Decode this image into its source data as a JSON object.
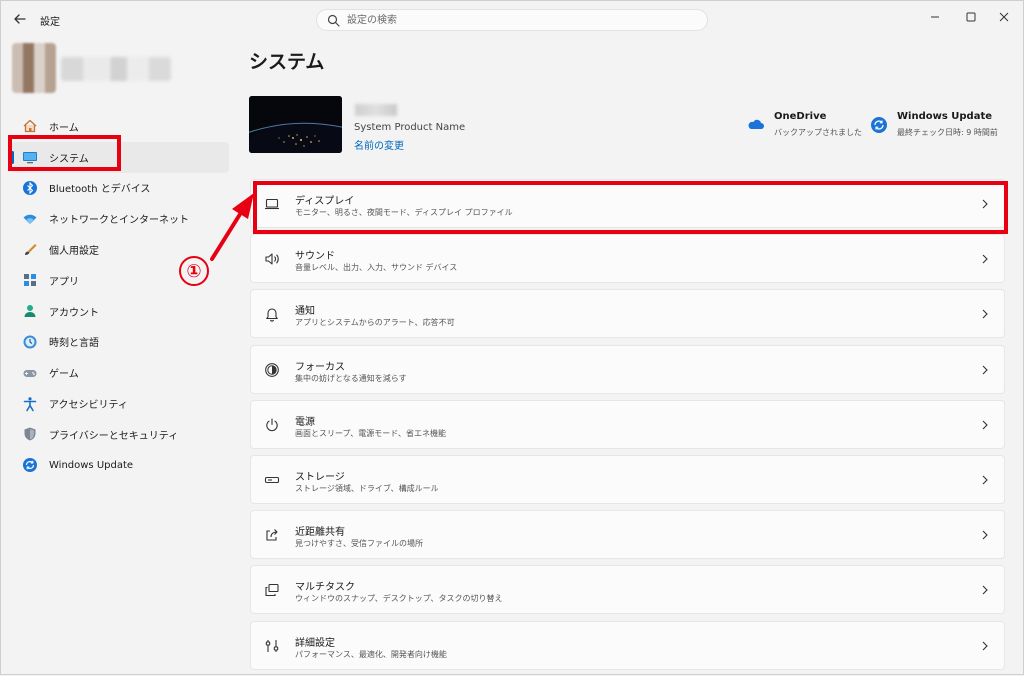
{
  "window": {
    "title": "設定"
  },
  "search": {
    "placeholder": "設定の検索"
  },
  "sidebar": {
    "items": [
      {
        "label": "ホーム",
        "icon": "home-icon",
        "selected": false
      },
      {
        "label": "システム",
        "icon": "system-icon",
        "selected": true
      },
      {
        "label": "Bluetooth とデバイス",
        "icon": "bluetooth-icon",
        "selected": false
      },
      {
        "label": "ネットワークとインターネット",
        "icon": "network-icon",
        "selected": false
      },
      {
        "label": "個人用設定",
        "icon": "personalization-icon",
        "selected": false
      },
      {
        "label": "アプリ",
        "icon": "apps-icon",
        "selected": false
      },
      {
        "label": "アカウント",
        "icon": "account-icon",
        "selected": false
      },
      {
        "label": "時刻と言語",
        "icon": "time-language-icon",
        "selected": false
      },
      {
        "label": "ゲーム",
        "icon": "gaming-icon",
        "selected": false
      },
      {
        "label": "アクセシビリティ",
        "icon": "accessibility-icon",
        "selected": false
      },
      {
        "label": "プライバシーとセキュリティ",
        "icon": "privacy-shield-icon",
        "selected": false
      },
      {
        "label": "Windows Update",
        "icon": "windows-update-icon",
        "selected": false
      }
    ]
  },
  "main": {
    "title": "システム",
    "device": {
      "model": "System Product Name",
      "rename_label": "名前の変更"
    },
    "services": {
      "onedrive": {
        "title": "OneDrive",
        "status": "バックアップされました"
      },
      "windows_update": {
        "title": "Windows Update",
        "status": "最終チェック日時: 9 時間前"
      }
    },
    "cards": [
      {
        "title": "ディスプレイ",
        "subtitle": "モニター、明るさ、夜間モード、ディスプレイ プロファイル",
        "icon": "display-icon"
      },
      {
        "title": "サウンド",
        "subtitle": "音量レベル、出力、入力、サウンド デバイス",
        "icon": "sound-icon"
      },
      {
        "title": "通知",
        "subtitle": "アプリとシステムからのアラート、応答不可",
        "icon": "notification-bell-icon"
      },
      {
        "title": "フォーカス",
        "subtitle": "集中の妨げとなる通知を減らす",
        "icon": "focus-icon"
      },
      {
        "title": "電源",
        "subtitle": "画面とスリープ、電源モード、省エネ機能",
        "icon": "power-icon"
      },
      {
        "title": "ストレージ",
        "subtitle": "ストレージ領域、ドライブ、構成ルール",
        "icon": "storage-icon"
      },
      {
        "title": "近距離共有",
        "subtitle": "見つけやすさ、受信ファイルの場所",
        "icon": "share-icon"
      },
      {
        "title": "マルチタスク",
        "subtitle": "ウィンドウのスナップ、デスクトップ、タスクの切り替え",
        "icon": "multitasking-icon"
      },
      {
        "title": "詳細設定",
        "subtitle": "パフォーマンス、最適化、開発者向け機能",
        "icon": "advanced-settings-icon"
      }
    ]
  },
  "annotation": {
    "step_number": "①"
  },
  "colors": {
    "accent": "#0067c0",
    "highlight": "#e60012",
    "background": "#f3f3f3",
    "card": "#fbfbfb"
  }
}
